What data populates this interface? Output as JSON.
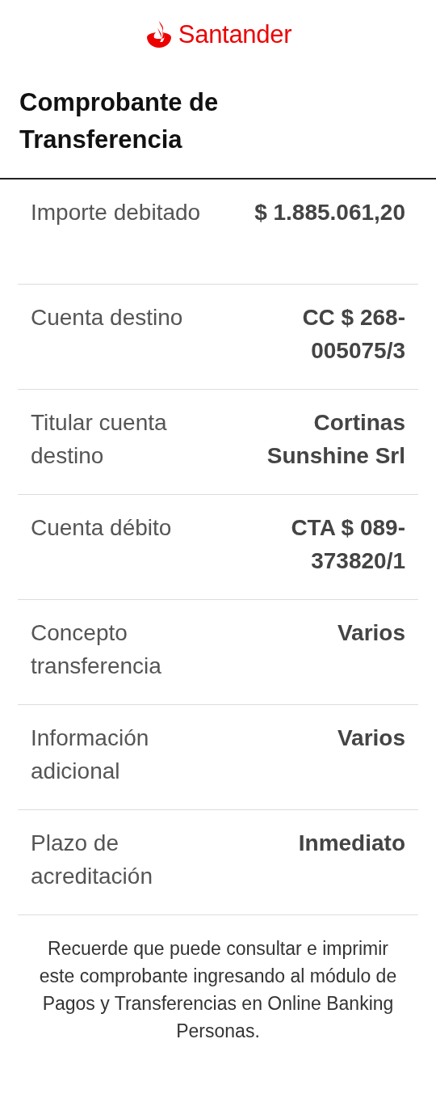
{
  "header": {
    "brand": "Santander"
  },
  "title": "Comprobante de Transferencia",
  "details": [
    {
      "label": "Importe debitado",
      "value": "$ 1.885.061,20"
    },
    {
      "label": "Cuenta destino",
      "value": "CC $ 268-005075/3"
    },
    {
      "label": "Titular cuenta destino",
      "value": "Cortinas Sunshine Srl"
    },
    {
      "label": "Cuenta débito",
      "value": "CTA $ 089-373820/1"
    },
    {
      "label": "Concepto transferencia",
      "value": "Varios"
    },
    {
      "label": "Información adicional",
      "value": "Varios"
    },
    {
      "label": "Plazo de acreditación",
      "value": "Inmediato"
    }
  ],
  "footer_note": "Recuerde que puede consultar e imprimir este comprobante ingresando al módulo de Pagos y Transferencias en Online Banking Personas."
}
